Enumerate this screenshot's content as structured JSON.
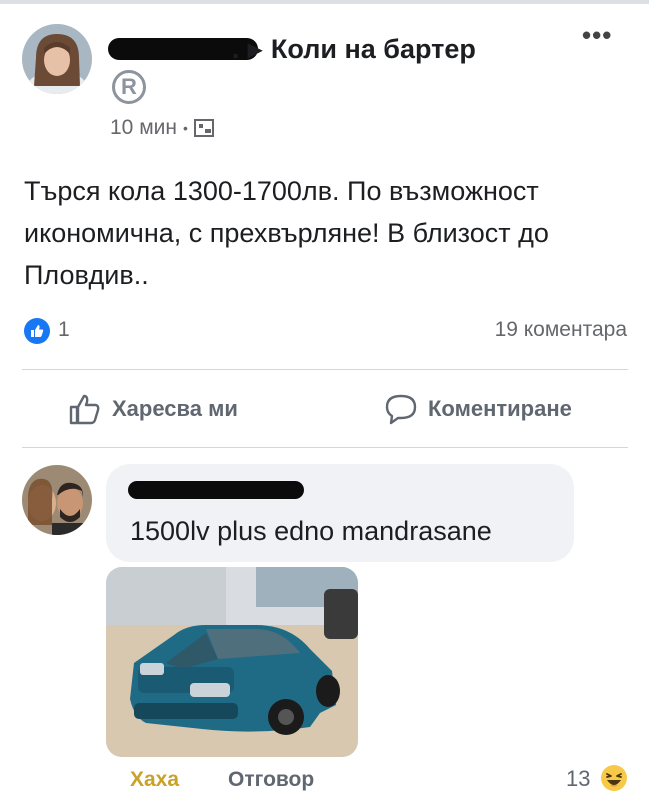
{
  "post": {
    "group_name": "Коли на бартер",
    "time": "10 мин",
    "body": "Търся кола 1300-1700лв. По възможност икономична, с прехвърляне! В близост до Пловдив..",
    "like_count": "1",
    "comments_count": "19 коментара"
  },
  "actions": {
    "like_label": "Харесва ми",
    "comment_label": "Коментиране"
  },
  "comment": {
    "text": "1500lv plus edno mandrasane",
    "haha_label": "Хаха",
    "reply_label": "Отговор",
    "reaction_count": "13"
  },
  "colors": {
    "like_blue": "#1877f2",
    "haha_gold": "#c9a227",
    "bubble_bg": "#f0f2f5"
  }
}
